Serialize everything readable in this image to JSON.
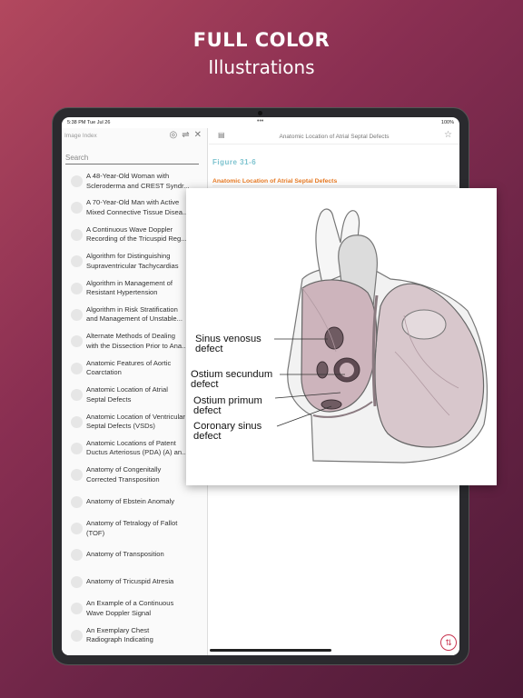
{
  "promo": {
    "line1": "FULL COLOR",
    "line2": "Illustrations"
  },
  "status": {
    "time": "5:38 PM   Tue Jul 26",
    "dots": "•••",
    "battery": "100%"
  },
  "sidebar": {
    "title": "Image Index",
    "search_placeholder": "Search",
    "items": [
      {
        "line1": "A 48-Year-Old Woman with",
        "line2": "Scleroderma and CREST Syndr..."
      },
      {
        "line1": "A 70-Year-Old Man with Active",
        "line2": "Mixed Connective Tissue Disea..."
      },
      {
        "line1": "A Continuous Wave Doppler",
        "line2": "Recording of the Tricuspid Reg..."
      },
      {
        "line1": "Algorithm for Distinguishing",
        "line2": "Supraventricular Tachycardias"
      },
      {
        "line1": "Algorithm in Management of",
        "line2": "Resistant Hypertension"
      },
      {
        "line1": "Algorithm in Risk Stratification",
        "line2": "and Management of Unstable..."
      },
      {
        "line1": "Alternate Methods of Dealing",
        "line2": "with the Dissection Prior to Ana..."
      },
      {
        "line1": "Anatomic Features of Aortic",
        "line2": "Coarctation"
      },
      {
        "line1": "Anatomic Location of Atrial",
        "line2": "Septal Defects"
      },
      {
        "line1": "Anatomic Location of Ventricular",
        "line2": "Septal Defects (VSDs)"
      },
      {
        "line1": "Anatomic Locations of Patent",
        "line2": "Ductus Arteriosus (PDA) (A) an..."
      },
      {
        "line1": "Anatomy of Congenitally",
        "line2": "Corrected Transposition"
      },
      {
        "line1": "Anatomy of Ebstein Anomaly",
        "line2": ""
      },
      {
        "line1": "Anatomy of Tetralogy of Fallot",
        "line2": "(TOF)"
      },
      {
        "line1": "Anatomy of Transposition",
        "line2": ""
      },
      {
        "line1": "Anatomy of Tricuspid Atresia",
        "line2": ""
      },
      {
        "line1": "An Example of a Continuous",
        "line2": "Wave Doppler Signal"
      },
      {
        "line1": "An Exemplary Chest",
        "line2": "Radiograph Indicating"
      }
    ]
  },
  "content": {
    "header_title": "Anatomic Location of Atrial Septal Defects",
    "figure_number": "Figure 31-6",
    "figure_title": "Anatomic Location of Atrial Septal Defects"
  },
  "figure_labels": {
    "sinus_1": "Sinus venosus",
    "sinus_2": "defect",
    "ostium_sec_1": "Ostium secundum",
    "ostium_sec_2": "defect",
    "ostium_pri_1": "Ostium primum",
    "ostium_pri_2": "defect",
    "coronary_1": "Coronary sinus",
    "coronary_2": "defect"
  },
  "colors": {
    "accent_teal": "#7dc3cf",
    "accent_orange": "#e87a23",
    "accent_red": "#c8334f"
  }
}
